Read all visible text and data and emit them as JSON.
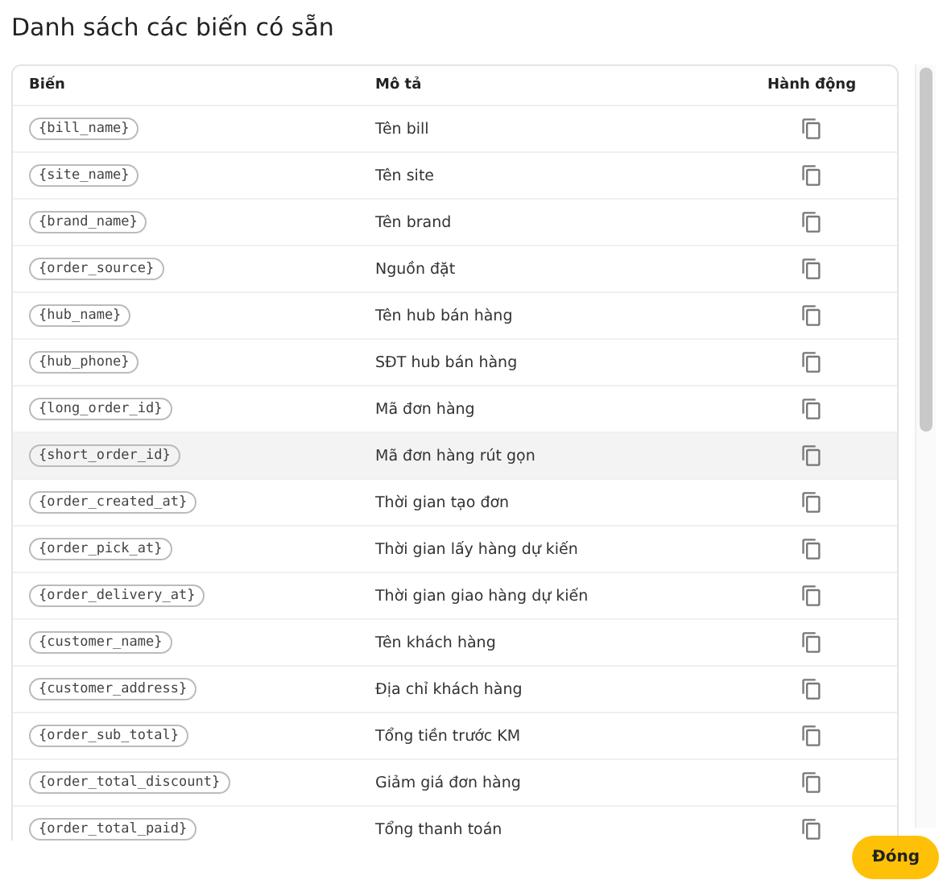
{
  "title": "Danh sách các biến có sẵn",
  "table": {
    "columns": [
      "Biến",
      "Mô tả",
      "Hành động"
    ],
    "rows": [
      {
        "variable": "{bill_name}",
        "description": "Tên bill",
        "highlighted": false
      },
      {
        "variable": "{site_name}",
        "description": "Tên site",
        "highlighted": false
      },
      {
        "variable": "{brand_name}",
        "description": "Tên brand",
        "highlighted": false
      },
      {
        "variable": "{order_source}",
        "description": "Nguồn đặt",
        "highlighted": false
      },
      {
        "variable": "{hub_name}",
        "description": "Tên hub bán hàng",
        "highlighted": false
      },
      {
        "variable": "{hub_phone}",
        "description": "SĐT hub bán hàng",
        "highlighted": false
      },
      {
        "variable": "{long_order_id}",
        "description": "Mã đơn hàng",
        "highlighted": false
      },
      {
        "variable": "{short_order_id}",
        "description": "Mã đơn hàng rút gọn",
        "highlighted": true
      },
      {
        "variable": "{order_created_at}",
        "description": "Thời gian tạo đơn",
        "highlighted": false
      },
      {
        "variable": "{order_pick_at}",
        "description": "Thời gian lấy hàng dự kiến",
        "highlighted": false
      },
      {
        "variable": "{order_delivery_at}",
        "description": "Thời gian giao hàng dự kiến",
        "highlighted": false
      },
      {
        "variable": "{customer_name}",
        "description": "Tên khách hàng",
        "highlighted": false
      },
      {
        "variable": "{customer_address}",
        "description": "Địa chỉ khách hàng",
        "highlighted": false
      },
      {
        "variable": "{order_sub_total}",
        "description": "Tổng tiền trước KM",
        "highlighted": false
      },
      {
        "variable": "{order_total_discount}",
        "description": "Giảm giá đơn hàng",
        "highlighted": false
      },
      {
        "variable": "{order_total_paid}",
        "description": "Tổng thanh toán",
        "highlighted": false
      }
    ]
  },
  "close_button": "Đóng"
}
